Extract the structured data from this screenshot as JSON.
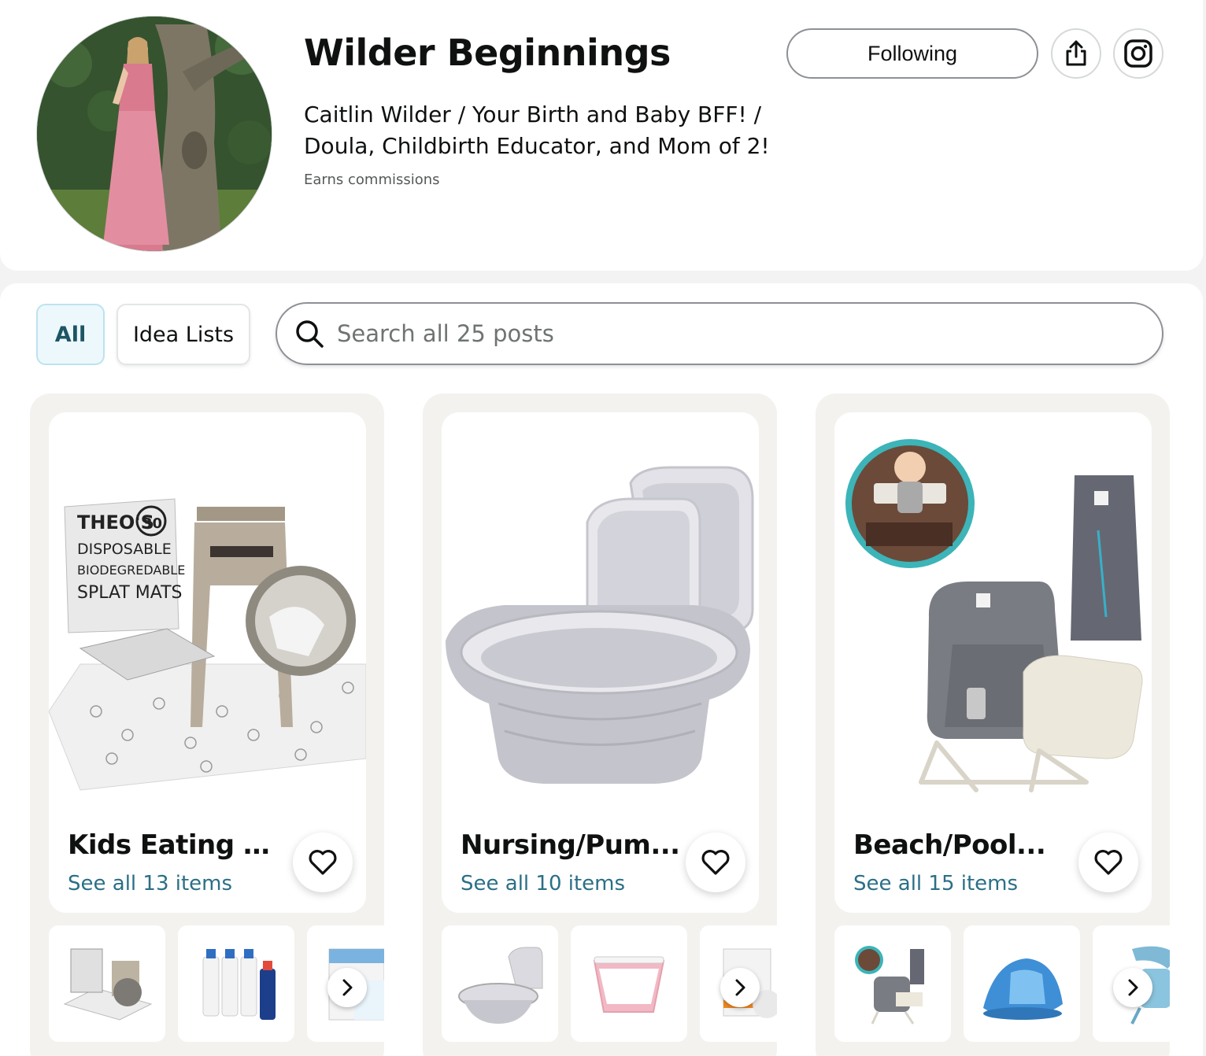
{
  "profile": {
    "store_name": "Wilder Beginnings",
    "bio_line1": "Caitlin Wilder / Your Birth and Baby BFF! /",
    "bio_line2": "Doula, Childbirth Educator, and Mom of 2!",
    "earns": "Earns commissions",
    "follow_label": "Following",
    "avatar_icon": "profile-photo",
    "share_icon": "share-icon",
    "instagram_icon": "instagram-icon"
  },
  "filters": {
    "tabs": [
      {
        "label": "All",
        "active": true
      },
      {
        "label": "Idea Lists",
        "active": false
      }
    ]
  },
  "search": {
    "placeholder": "Search all 25 posts",
    "icon": "search-icon"
  },
  "lists": [
    {
      "title": "Kids Eating O...",
      "link": "See all 13 items",
      "hero_text": [
        "THEO'S",
        "30",
        "DISPOSABLE",
        "BIODEGREDABLE",
        "SPLAT MATS"
      ],
      "thumbs": [
        "splat-mats-thumb",
        "stain-treater-bottles-thumb",
        "stain-treater-wipes-thumb"
      ]
    },
    {
      "title": "Nursing/Pum...",
      "link": "See all 10 items",
      "hero_text": [],
      "thumbs": [
        "collapsible-basin-thumb",
        "pink-collapsible-basin-thumb",
        "bottle-product-thumb"
      ]
    },
    {
      "title": "Beach/Pool...",
      "link": "See all 15 items",
      "hero_text": [],
      "thumbs": [
        "booster-seat-thumb",
        "baby-beach-tent-thumb",
        "canopy-seat-thumb"
      ]
    }
  ],
  "colors": {
    "accent_link": "#2b6f86",
    "tab_active_bg": "#edf8fc",
    "card_bg": "#f3f2ef"
  }
}
